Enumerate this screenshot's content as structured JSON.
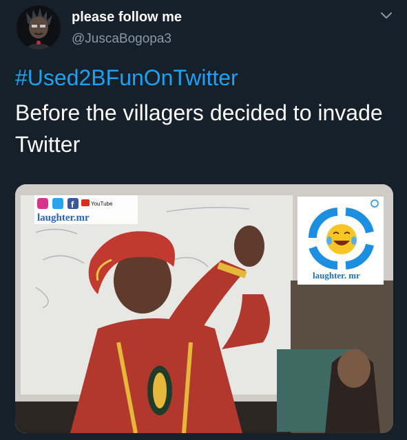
{
  "tweet": {
    "display_name": "please follow me",
    "handle": "@JuscaBogopa3",
    "hashtag": "#Used2BFunOnTwitter",
    "text": "Before the villagers decided to invade Twitter"
  },
  "media": {
    "watermark_top_left": "laughter.mr",
    "youtube_label": "YouTube",
    "watermark_logo_text": "laughter. mr",
    "emoji": "😂"
  },
  "icons": {
    "avatar": "avatar-image",
    "chevron": "chevron-down-icon"
  },
  "colors": {
    "background": "#15202b",
    "link": "#1da1f2",
    "secondary_text": "#8899a6"
  }
}
